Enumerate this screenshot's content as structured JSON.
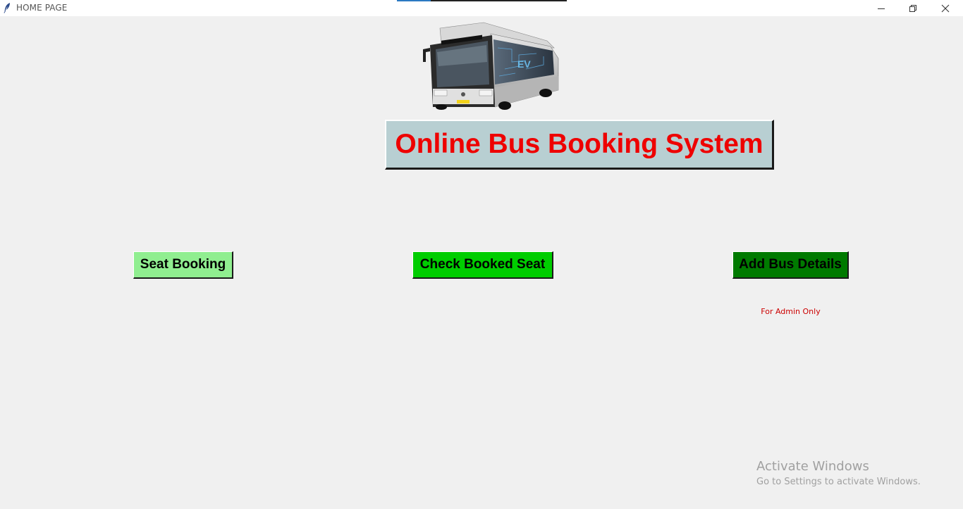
{
  "window": {
    "title": "HOME PAGE",
    "controls": {
      "minimize_icon": "minimize-icon",
      "restore_icon": "restore-icon",
      "close_icon": "close-icon"
    }
  },
  "header": {
    "image_icon": "bus-image",
    "title": "Online Bus Booking System",
    "title_color": "#ee0000",
    "title_background": "#b8cfd2"
  },
  "actions": {
    "seat_booking": {
      "label": "Seat Booking",
      "color": "#90ee90"
    },
    "check_booked_seat": {
      "label": "Check Booked Seat",
      "color": "#00cd00"
    },
    "add_bus_details": {
      "label": "Add Bus Details",
      "color": "#007a00",
      "note": "For Admin Only",
      "note_color": "#cc0000"
    }
  },
  "watermark": {
    "title": "Activate Windows",
    "subtitle": "Go to Settings to activate Windows."
  }
}
